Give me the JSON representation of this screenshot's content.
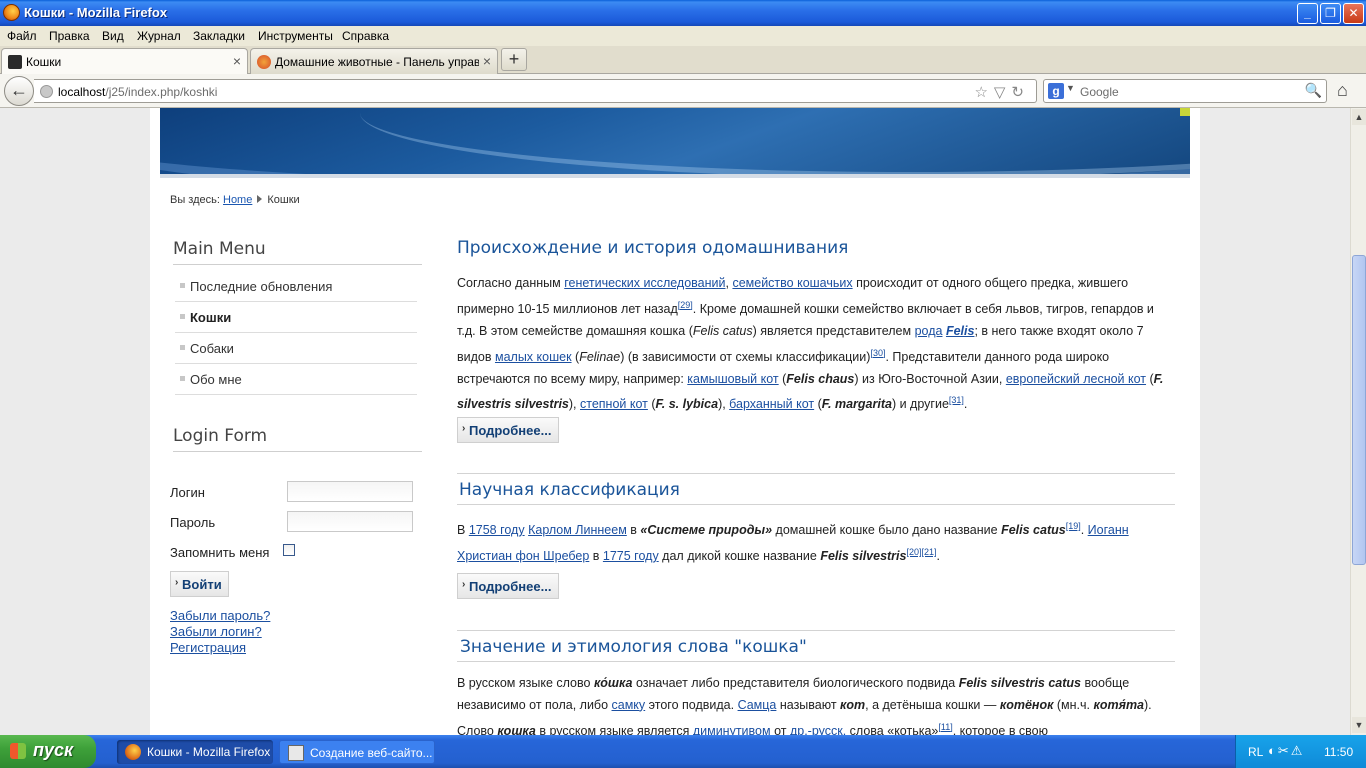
{
  "window": {
    "title": "Кошки - Mozilla Firefox",
    "min": "_",
    "max": "❐",
    "close": "✕"
  },
  "menubar": [
    "Файл",
    "Правка",
    "Вид",
    "Журнал",
    "Закладки",
    "Инструменты",
    "Справка"
  ],
  "tabs": [
    {
      "label": "Кошки",
      "close": "×"
    },
    {
      "label": "Домашние животные - Панель управл...",
      "close": "×"
    }
  ],
  "newtab_label": "+",
  "nav": {
    "back": "←",
    "url_host": "localhost",
    "url_path": "/j25/index.php/koshki",
    "url_icons": "☆▽↻",
    "search_engine": "g",
    "search_placeholder": "Google",
    "search_glass": "🔍",
    "home": "⌂"
  },
  "breadcrumb": {
    "prefix": "Вы здесь:",
    "home": "Home",
    "current": "Кошки"
  },
  "main_menu": {
    "title": "Main Menu",
    "items": [
      "Последние обновления",
      "Кошки",
      "Собаки",
      "Обо мне"
    ],
    "active_index": 1
  },
  "login": {
    "title": "Login Form",
    "username_label": "Логин",
    "password_label": "Пароль",
    "remember_label": "Запомнить меня",
    "submit": "Войти",
    "links": [
      "Забыли пароль?",
      "Забыли логин?",
      "Регистрация"
    ]
  },
  "articles": [
    {
      "title": "Происхождение и история одомашнивания",
      "readmore": "Подробнее..."
    },
    {
      "title": "Научная классификация",
      "readmore": "Подробнее..."
    },
    {
      "title": "Значение и этимология слова \"кошка\""
    }
  ],
  "article1_text": {
    "a": "Согласно данным ",
    "l1": "генетических исследований",
    "b": ", ",
    "l2": "семейство кошачьих",
    "c": " происходит от одного общего предка, жившего примерно 10-15 миллионов лет назад",
    "r1": "[29]",
    "d": ". Кроме домашней кошки семейство включает в себя львов, тигров, гепардов и т.д. В этом семействе домашняя кошка (",
    "e1": "Felis catus",
    "f": ") является представителем ",
    "l3": "рода",
    "g": " ",
    "l4": "Felis",
    "h": "; в него также входят около 7 видов ",
    "l5": "малых кошек",
    "i": " (",
    "e2": "Felinae",
    "j": ") (в зависимости от схемы классификации)",
    "r2": "[30]",
    "k": ". Представители данного рода широко встречаются по всему миру, например: ",
    "l6": "камышовый кот",
    "m": " (",
    "e3": "Felis chaus",
    "n": ") из Юго-Восточной Азии, ",
    "l7": "европейский лесной кот",
    "o": " (",
    "e4": "F. silvestris silvestris",
    "p": "), ",
    "l8": "степной кот",
    "q": " (",
    "e5": "F. s. lybica",
    "s": "), ",
    "l9": "барханный кот",
    "t": " (",
    "e6": "F. margarita",
    "u": ") и другие",
    "r3": "[31]",
    "v": "."
  },
  "article2_text": {
    "a": "В ",
    "l1": "1758 году",
    "b": " ",
    "l2": "Карлом Линнеем",
    "c": " в ",
    "e1": "«Системе природы»",
    "d": " домашней кошке было дано название ",
    "e2": "Felis catus",
    "r1": "[19]",
    "e": ". ",
    "l3": "Иоганн Христиан фон Шребер",
    "f": " в ",
    "l4": "1775 году",
    "g": " дал дикой кошке название ",
    "e3": "Felis silvestris",
    "r2": "[20][21]",
    "h": "."
  },
  "article3_text": {
    "a": "В русском языке слово ",
    "e1": "ко́шка",
    "b": " означает либо представителя биологического подвида ",
    "e2": "Felis silvestris catus",
    "c": " вообще независимо от пола, либо ",
    "l1": "самку",
    "d": " этого подвида. ",
    "l2": "Самца",
    "e": " называют ",
    "e3": "кот",
    "f": ", а детёныша кошки — ",
    "e4": "котёнок",
    "g": " (мн.ч. ",
    "e5": "котя́та",
    "h": "). Слово ",
    "e6": "кошка",
    "i": " в русском языке является ",
    "l3": "диминутивом",
    "j": " от ",
    "l4": "др.-русск.",
    "k": " слова «котька»",
    "r1": "[11]",
    "m": ", которое в свою"
  },
  "taskbar": {
    "start": "пуск",
    "items": [
      "Кошки - Mozilla Firefox",
      "Создание веб-сайто..."
    ],
    "lang": "RL",
    "clock": "11:50"
  },
  "colors": {
    "link": "#1b4fa0",
    "heading": "#1a5499",
    "titlebar": "#2a6fe8",
    "taskbar": "#2460cf",
    "start": "#3ea13a"
  }
}
